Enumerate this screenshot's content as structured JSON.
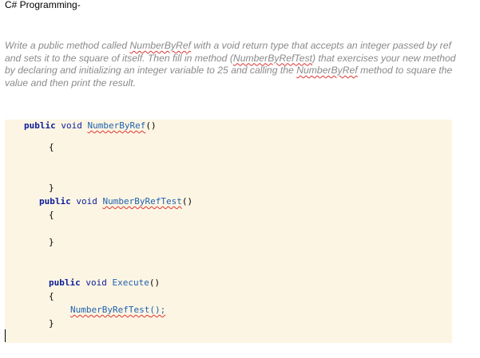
{
  "title": "C# Programming-",
  "instructions": {
    "part1": "Write a public method called ",
    "method1": "NumberByRef",
    "part2": " with a void return type that accepts an integer passed by ref and sets it to the square of itself.  Then fill in method (",
    "method2": "NumberByRefTest",
    "part3": ") that exercises your new method by declaring and initializing an integer variable to 25 and calling the ",
    "method3": "NumberByRef",
    "part4": " method to square the value and then print the result."
  },
  "code": {
    "kw_public": "public",
    "kw_void": "void",
    "m1_name": "NumberByRef",
    "m2_name": "NumberByRefTest",
    "m3_name": "Execute",
    "call_name": "NumberByRefTest",
    "parens": "()",
    "call_suffix": "();",
    "open_brace": "{",
    "close_brace": "}"
  },
  "colors": {
    "code_background": "#fdf5e3",
    "keyword": "#0b1d9c",
    "method": "#1d62b0",
    "instruction_text": "#8a8a8a"
  }
}
